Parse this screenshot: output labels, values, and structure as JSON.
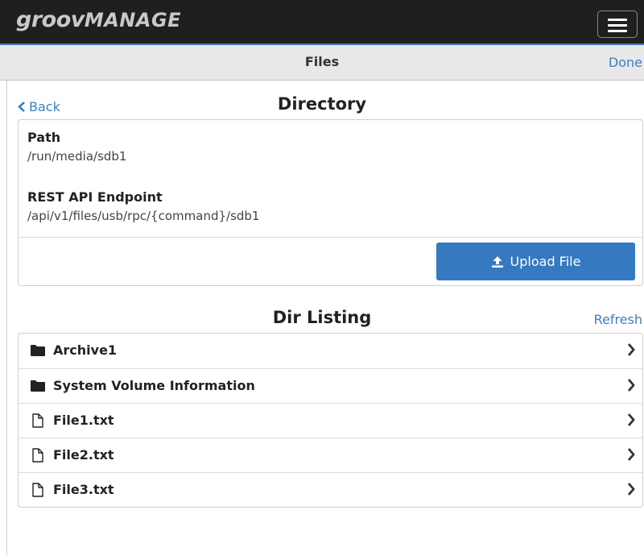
{
  "header": {
    "logo_part1": "groov",
    "logo_part2": "MANAGE",
    "menu_icon": "hamburger-icon"
  },
  "page": {
    "title": "Files",
    "done_label": "Done"
  },
  "directory": {
    "back_label": "Back",
    "title": "Directory",
    "path_label": "Path",
    "path_value": "/run/media/sdb1",
    "endpoint_label": "REST API Endpoint",
    "endpoint_value": "/api/v1/files/usb/rpc/{command}/sdb1",
    "upload_label": "Upload File"
  },
  "listing": {
    "title": "Dir Listing",
    "refresh_label": "Refresh",
    "items": [
      {
        "name": "Archive1",
        "type": "folder"
      },
      {
        "name": "System Volume Information",
        "type": "folder"
      },
      {
        "name": "File1.txt",
        "type": "file"
      },
      {
        "name": "File2.txt",
        "type": "file"
      },
      {
        "name": "File3.txt",
        "type": "file"
      }
    ]
  },
  "colors": {
    "accent": "#3f7fc1",
    "button": "#3579c0",
    "topbar": "#1f1f1f"
  }
}
